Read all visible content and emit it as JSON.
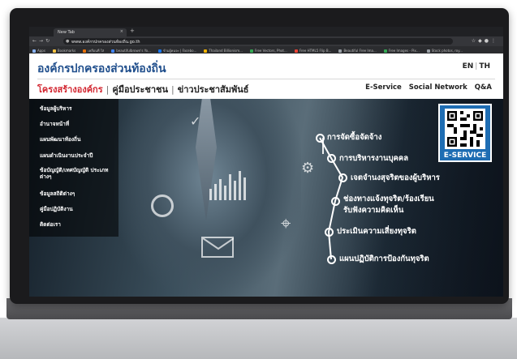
{
  "browser": {
    "tab_title": "New Tab",
    "url": "www.องค์กรปกครองส่วนท้องถิ่น.go.th",
    "bookmarks": [
      "Apps",
      "Bookmarks",
      "เคลื่อนที่ ใส่",
      "beautifulbrown's Yo...",
      "ข้ามผู้คนจะ | Facebo...",
      "Thailand Billionism...",
      "Free Vectors, Phot...",
      "Free HTML5 Flip B...",
      "Beautiful Free Ima...",
      "Free Images - Pix...",
      "Stock photos, roy..."
    ],
    "bookmark_colors": [
      "#8ab4f8",
      "#f6c343",
      "#e8710a",
      "#4285f4",
      "#1877f2",
      "#f4b400",
      "#34a853",
      "#ea4335",
      "#9aa0a6",
      "#34a853",
      "#9aa0a6"
    ]
  },
  "site": {
    "title": "องค์กรปกครองส่วนท้องถิ่น",
    "lang_en": "EN",
    "lang_th": "TH",
    "nav": [
      "โครงสร้างองค์กร",
      "คู่มือประชาชน",
      "ข่าวประชาสัมพันธ์"
    ],
    "right_nav": [
      "E-Service",
      "Social Network",
      "Q&A"
    ],
    "accent": "#d22630",
    "brand": "#1f4e8c"
  },
  "sidebar": {
    "items": [
      "ข้อมูลผู้บริหาร",
      "อำนาจหน้าที่",
      "แผนพัฒนาท้องถิ่น",
      "แผนดำเนินงานประจำปี",
      "ข้อบัญญัติ/เทศบัญญัติ ประเภทต่างๆ",
      "ข้อมูลสถิติต่างๆ",
      "คู่มือปฏิบัติงาน",
      "ติดต่อเรา"
    ]
  },
  "hero": {
    "links": [
      "การจัดซื้อจัดจ้าง",
      "การบริหารงานบุคคล",
      "เจตจำนงสุจริตของผู้บริหาร",
      "ช่องทางแจ้งทุจริต/ร้องเรียน",
      "รับฟังความคิดเห็น",
      "ประเมินความเสี่ยงทุจริต",
      "แผนปฏิบัติการป้องกันทุจริต"
    ],
    "qr_label": "E-SERVICE",
    "qr_color": "#1e6db3"
  }
}
